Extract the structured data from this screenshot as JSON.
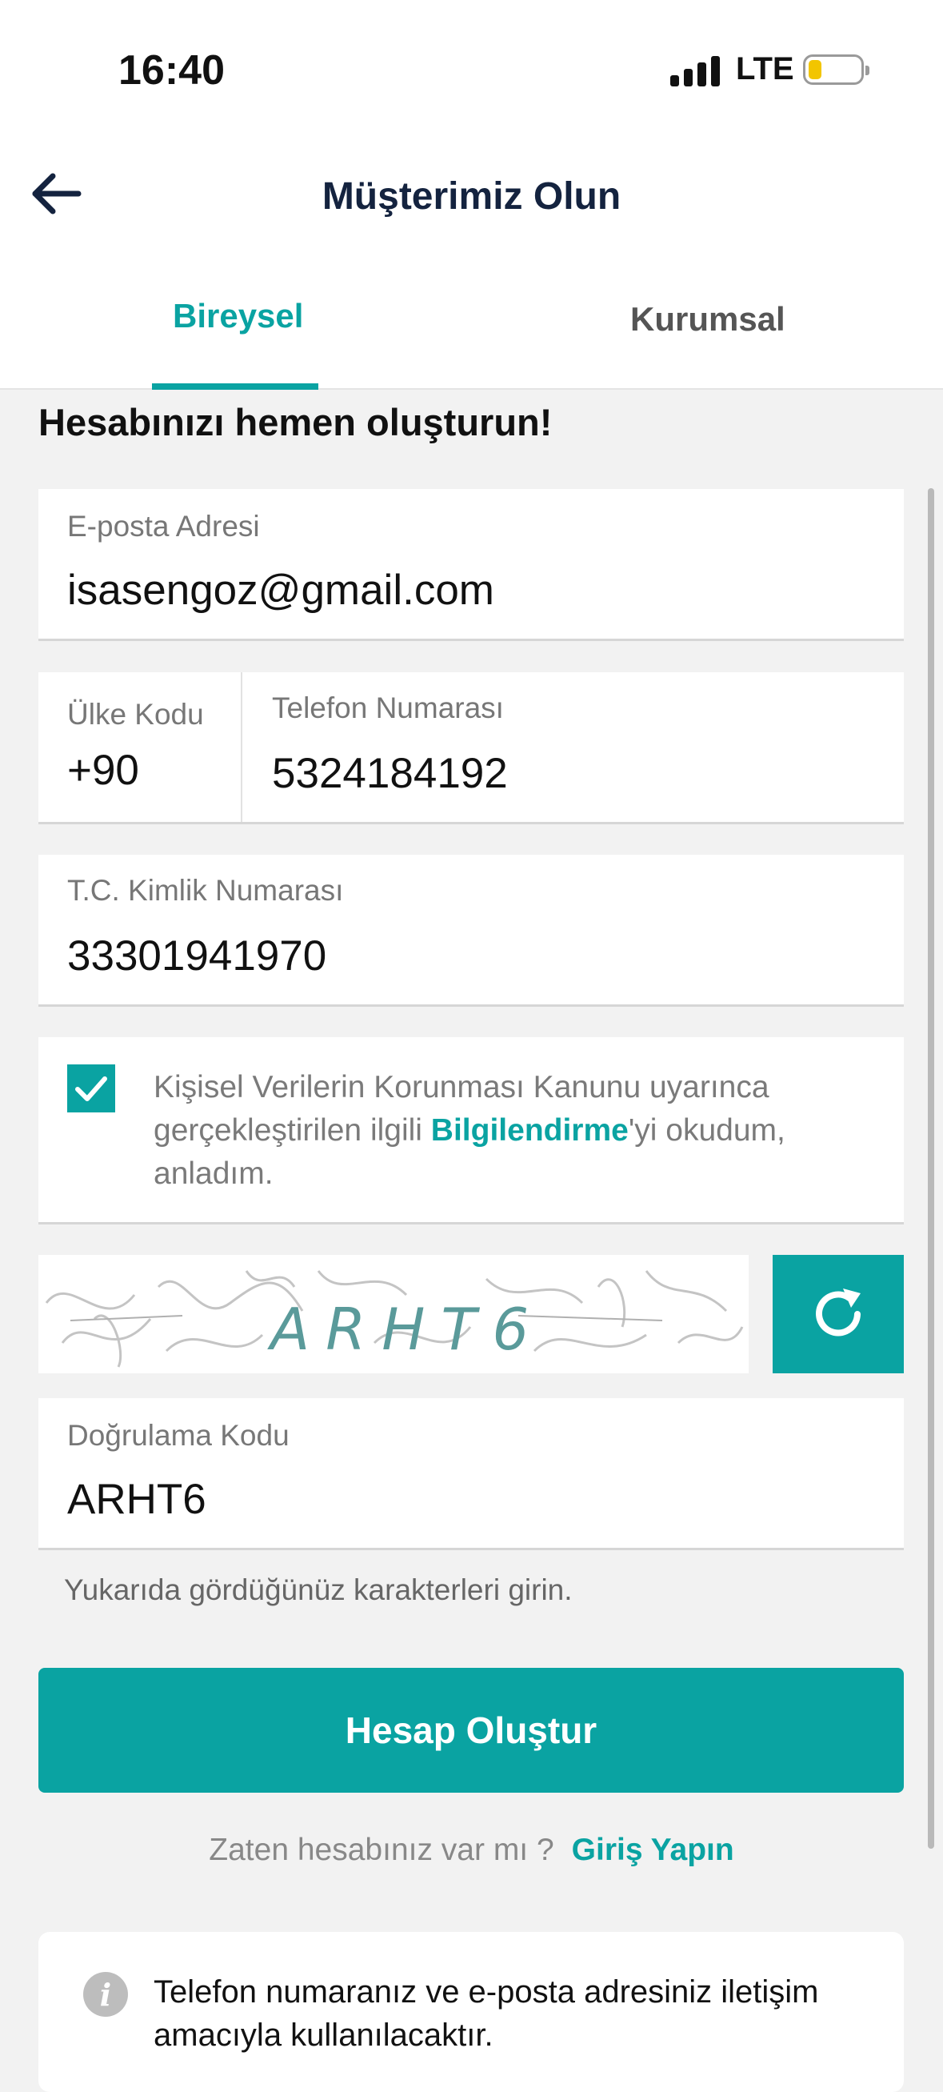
{
  "status_bar": {
    "time": "16:40",
    "network": "LTE"
  },
  "nav": {
    "title": "Müşterimiz Olun"
  },
  "tabs": [
    {
      "label": "Bireysel",
      "active": true
    },
    {
      "label": "Kurumsal",
      "active": false
    }
  ],
  "heading": "Hesabınızı hemen oluşturun!",
  "email": {
    "label": "E-posta Adresi",
    "value": "isasengoz@gmail.com"
  },
  "country_code": {
    "label": "Ülke Kodu",
    "value": "+90"
  },
  "phone": {
    "label": "Telefon Numarası",
    "value": "5324184192"
  },
  "national_id": {
    "label": "T.C. Kimlik Numarası",
    "value": "33301941970"
  },
  "consent": {
    "checked": true,
    "text_before": "Kişisel Verilerin Korunması Kanunu uyarınca gerçekleştirilen ilgili ",
    "link": "Bilgilendirme",
    "text_after": "'yi okudum, anladım."
  },
  "captcha": {
    "text": "ARHT6"
  },
  "verification": {
    "label": "Doğrulama Kodu",
    "value": "ARHT6",
    "hint": "Yukarıda gördüğünüz karakterleri girin."
  },
  "submit_label": "Hesap Oluştur",
  "login": {
    "question": "Zaten hesabınız var mı ?",
    "link": "Giriş Yapın"
  },
  "info": {
    "text": "Telefon numaranız ve e-posta adresiniz iletişim amacıyla kullanılacaktır."
  },
  "colors": {
    "accent": "#0aa3a2",
    "title": "#14233f",
    "background": "#f2f2f2"
  },
  "icons": {
    "back": "arrow-left-icon",
    "refresh": "refresh-icon",
    "check": "check-icon",
    "info": "info-icon"
  }
}
